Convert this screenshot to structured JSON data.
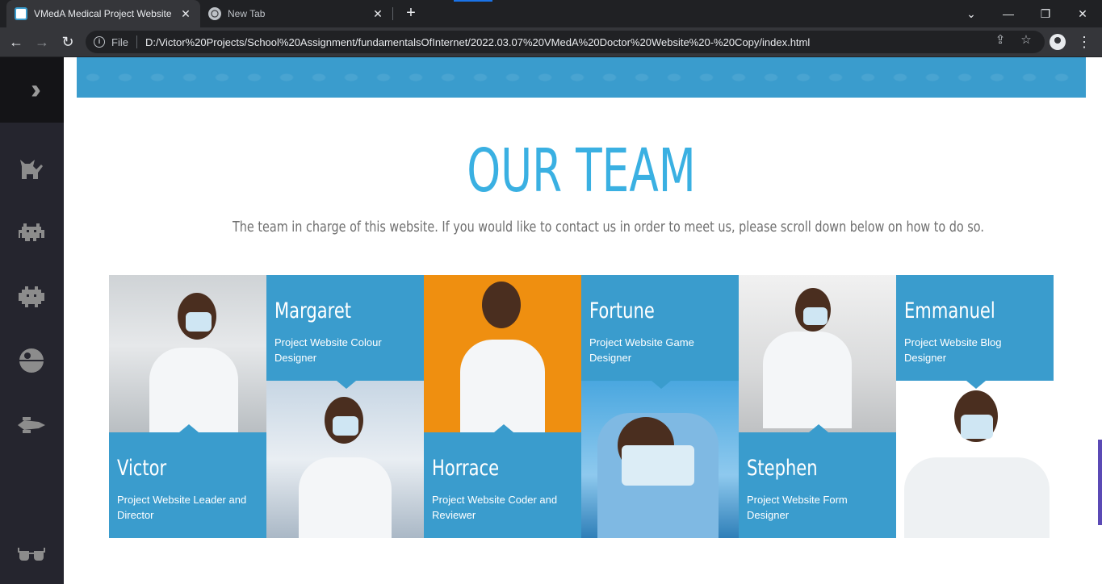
{
  "browser": {
    "tabs": [
      {
        "title": "VMedA Medical Project Website",
        "active": true
      },
      {
        "title": "New Tab",
        "active": false
      }
    ],
    "omnibox": {
      "scheme_label": "File",
      "url": "D:/Victor%20Projects/School%20Assignment/fundamentalsOfInternet/2022.03.07%20VMedA%20Doctor%20Website%20-%20Copy/index.html"
    }
  },
  "sidenav": {
    "icons": [
      "double-chevron-right-icon",
      "cat-icon",
      "space-invader-icon",
      "space-invader-alt-icon",
      "death-star-icon",
      "spaceship-icon",
      "glasses-icon"
    ]
  },
  "section": {
    "title": "OUR TEAM",
    "subtitle": "The team in charge of this website. If you would like to contact us in order to meet us, please scroll down below on how to do so."
  },
  "team": [
    {
      "name": "Victor",
      "role": "Project Website Leader and Director"
    },
    {
      "name": "Margaret",
      "role": "Project Website Colour Designer"
    },
    {
      "name": "Horrace",
      "role": "Project Website Coder and Reviewer"
    },
    {
      "name": "Fortune",
      "role": "Project Website Game Designer"
    },
    {
      "name": "Stephen",
      "role": "Project Website Form Designer"
    },
    {
      "name": "Emmanuel",
      "role": "Project Website Blog Designer"
    }
  ],
  "colors": {
    "accent": "#3a9ccd",
    "title": "#3ab0e2",
    "sidenav": "#25252e"
  }
}
